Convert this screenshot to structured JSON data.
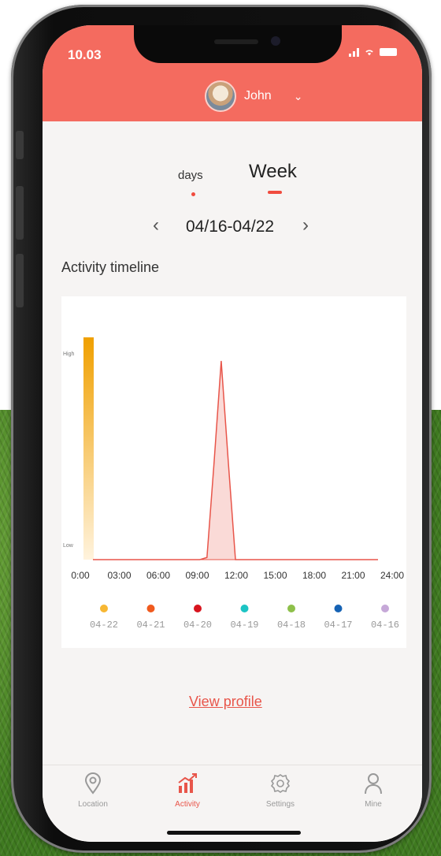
{
  "status_bar": {
    "time": "10.03"
  },
  "header": {
    "user_name": "John",
    "accent_color": "#f46b5f"
  },
  "period_tabs": [
    {
      "label": "days",
      "active": false
    },
    {
      "label": "Week",
      "active": true
    }
  ],
  "date_nav": {
    "prev_icon": "chevron-left-icon",
    "range": "04/16-04/22",
    "next_icon": "chevron-right-icon"
  },
  "section_title": "Activity timeline",
  "chart_data": {
    "type": "area",
    "title": "",
    "xlabel": "",
    "ylabel": "",
    "y_ticks": [
      "High",
      "Low"
    ],
    "x_ticks": [
      "0:00",
      "03:00",
      "06:00",
      "09:00",
      "12:00",
      "15:00",
      "18:00",
      "21:00",
      "24:00"
    ],
    "xlim": [
      0,
      24
    ],
    "ylim": [
      0,
      1
    ],
    "series": [
      {
        "name": "04-20",
        "color": "#e8554a",
        "x": [
          0,
          9,
          9.6,
          10.2,
          10.8,
          11.4,
          12,
          24
        ],
        "y": [
          0,
          0,
          0.01,
          0.45,
          0.92,
          0.45,
          0.0,
          0
        ]
      }
    ],
    "gradient_bar": {
      "from_color": "#f0a000",
      "to_color": "#fff3dd"
    },
    "legend": [
      {
        "label": "04-22",
        "color": "#f7b733"
      },
      {
        "label": "04-21",
        "color": "#f05a1e"
      },
      {
        "label": "04-20",
        "color": "#d8141e"
      },
      {
        "label": "04-19",
        "color": "#1cc4c4"
      },
      {
        "label": "04-18",
        "color": "#8ec04a"
      },
      {
        "label": "04-17",
        "color": "#1562b4"
      },
      {
        "label": "04-16",
        "color": "#c6a8d8"
      }
    ]
  },
  "view_profile": "View profile",
  "bottom_nav": [
    {
      "label": "Location",
      "icon": "location-pin-icon",
      "active": false
    },
    {
      "label": "Activity",
      "icon": "activity-chart-icon",
      "active": true
    },
    {
      "label": "Settings",
      "icon": "gear-icon",
      "active": false
    },
    {
      "label": "Mine",
      "icon": "person-icon",
      "active": false
    }
  ]
}
